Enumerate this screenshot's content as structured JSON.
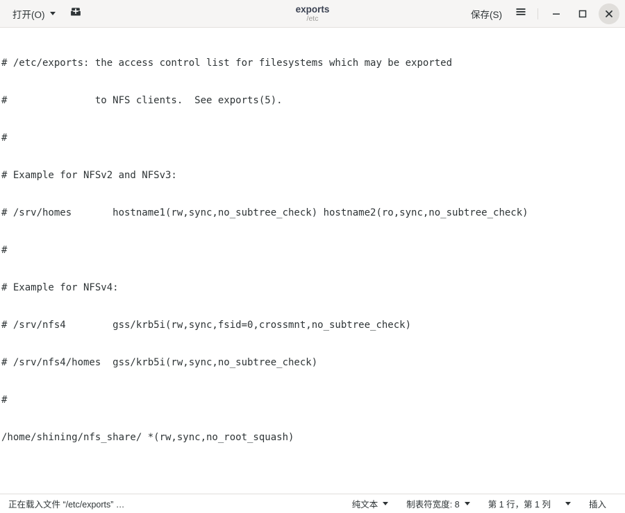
{
  "header": {
    "open_button": "打开(O)",
    "open_button_icon": "chevron-down-icon",
    "new_document_icon": "new-document-icon",
    "title": "exports",
    "subtitle": "/etc",
    "save_button": "保存(S)",
    "menu_icon": "hamburger-menu-icon",
    "minimize_icon": "minimize-icon",
    "maximize_icon": "maximize-icon",
    "close_icon": "close-icon"
  },
  "editor": {
    "lines": [
      "# /etc/exports: the access control list for filesystems which may be exported",
      "#               to NFS clients.  See exports(5).",
      "#",
      "# Example for NFSv2 and NFSv3:",
      "# /srv/homes       hostname1(rw,sync,no_subtree_check) hostname2(ro,sync,no_subtree_check)",
      "#",
      "# Example for NFSv4:",
      "# /srv/nfs4        gss/krb5i(rw,sync,fsid=0,crossmnt,no_subtree_check)",
      "# /srv/nfs4/homes  gss/krb5i(rw,sync,no_subtree_check)",
      "#",
      "/home/shining/nfs_share/ *(rw,sync,no_root_squash)"
    ]
  },
  "statusbar": {
    "loading_message": "正在载入文件 “/etc/exports” …",
    "syntax": "纯文本",
    "tab_width": "制表符宽度: 8",
    "cursor_position": "第 1 行，第 1 列",
    "insert_mode": "插入"
  },
  "colors": {
    "headerbar_bg": "#f6f5f4",
    "editor_bg": "#ffffff",
    "text": "#2e3436",
    "title": "#3b4252",
    "subtitle": "#9a9996",
    "close_button_bg": "#e0dedb",
    "border": "#e0dedb"
  }
}
